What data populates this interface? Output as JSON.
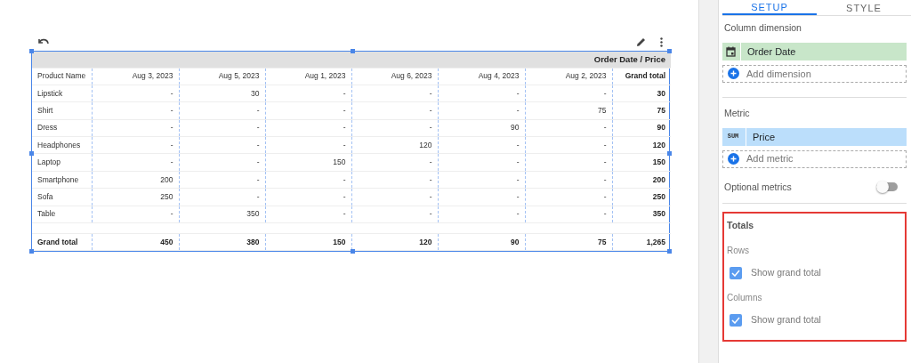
{
  "table": {
    "header_title": "Order Date / Price",
    "columns": [
      "Product Name",
      "Aug 3, 2023",
      "Aug 5, 2023",
      "Aug 1, 2023",
      "Aug 6, 2023",
      "Aug 4, 2023",
      "Aug 2, 2023",
      "Grand total"
    ],
    "rows": [
      [
        "Lipstick",
        "-",
        "30",
        "-",
        "-",
        "-",
        "-",
        "30"
      ],
      [
        "Shirt",
        "-",
        "-",
        "-",
        "-",
        "-",
        "75",
        "75"
      ],
      [
        "Dress",
        "-",
        "-",
        "-",
        "-",
        "90",
        "-",
        "90"
      ],
      [
        "Headphones",
        "-",
        "-",
        "-",
        "120",
        "-",
        "-",
        "120"
      ],
      [
        "Laptop",
        "-",
        "-",
        "150",
        "-",
        "-",
        "-",
        "150"
      ],
      [
        "Smartphone",
        "200",
        "-",
        "-",
        "-",
        "-",
        "-",
        "200"
      ],
      [
        "Sofa",
        "250",
        "-",
        "-",
        "-",
        "-",
        "-",
        "250"
      ],
      [
        "Table",
        "-",
        "350",
        "-",
        "-",
        "-",
        "-",
        "350"
      ]
    ],
    "total_row": [
      "Grand total",
      "450",
      "380",
      "150",
      "120",
      "90",
      "75",
      "1,265"
    ]
  },
  "panel": {
    "tabs": [
      {
        "label": "SETUP",
        "selected": true
      },
      {
        "label": "STYLE",
        "selected": false
      }
    ],
    "column_dimension": {
      "title": "Column dimension",
      "field": "Order Date",
      "add": "Add dimension"
    },
    "metric": {
      "title": "Metric",
      "aggregation": "SUM",
      "field": "Price",
      "add": "Add metric"
    },
    "optional_metrics": {
      "label": "Optional metrics",
      "on": false
    },
    "totals": {
      "title": "Totals",
      "groups": [
        {
          "label": "Rows",
          "option": "Show grand total",
          "checked": true
        },
        {
          "label": "Columns",
          "option": "Show grand total",
          "checked": true
        }
      ]
    }
  }
}
